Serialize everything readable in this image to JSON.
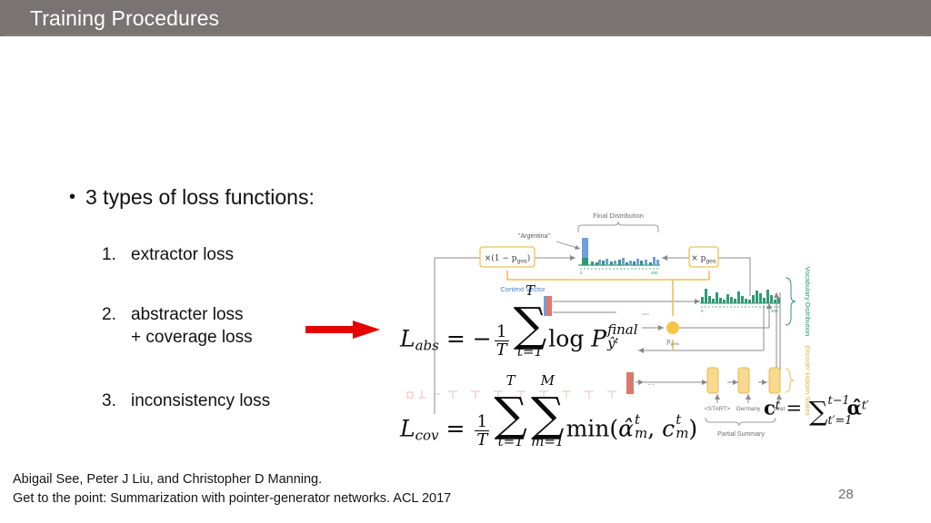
{
  "slide": {
    "title": "Training Procedures",
    "title_bar_color": "#7a7472",
    "background_color": "#ffffff",
    "page_number": "28"
  },
  "content": {
    "lead_bullet_glyph": "•",
    "lead_text": "3 types of loss functions:",
    "items": [
      {
        "index": "1.",
        "line1": "extractor loss",
        "line2": ""
      },
      {
        "index": "2.",
        "line1": "abstracter loss",
        "line2": "+ coverage loss"
      },
      {
        "index": "3.",
        "line1": "inconsistency loss",
        "line2": ""
      }
    ]
  },
  "arrow": {
    "name": "red-arrow",
    "color": "#E60000",
    "direction": "right"
  },
  "equations": {
    "abs": {
      "lhs": "L",
      "lhs_sub": "abs",
      "eq": "=",
      "minus": "−",
      "frac_num": "1",
      "frac_den": "T",
      "sigma": "∑",
      "sigma_top": "T",
      "sigma_bottom": "t=1",
      "log": "log",
      "p": "P",
      "p_sup": "final",
      "p_sub": "ŷᵗ"
    },
    "cov": {
      "lhs": "L",
      "lhs_sub": "cov",
      "eq": "=",
      "frac_num": "1",
      "frac_den": "T",
      "sigma1": "∑",
      "sigma1_top": "T",
      "sigma1_bottom": "t=1",
      "sigma2": "∑",
      "sigma2_top": "M",
      "sigma2_bottom": "m=1",
      "min": "min(",
      "alpha": "α̂",
      "alpha_sup": "t",
      "alpha_sub": "m",
      "comma": ", ",
      "c": "c",
      "c_sup": "t",
      "c_sub": "m",
      "close": ")"
    },
    "ct": {
      "lhs": "c",
      "lhs_sup": "t",
      "eq": "=",
      "sigma": "∑",
      "sigma_top": "t−1",
      "sigma_bottom": "t′=1",
      "alpha": "α̂",
      "alpha_sup": "t′"
    }
  },
  "figure": {
    "caption_final_distribution": "Final Distribution",
    "label_argentina": "\"Argentina\"",
    "label_times_one_minus_pgen": "×(1 − p",
    "label_times_one_minus_pgen_sub": "gen",
    "label_times_one_minus_pgen_end": ")",
    "label_times_pgen": "× p",
    "label_times_pgen_sub": "gen",
    "label_context_vector": "Context Vector",
    "label_vocabulary_distribution": "Vocabulary Distribution",
    "label_decoder_hidden_states": "Decoder Hidden States",
    "label_pgen": "p",
    "label_pgen_sub": "gen",
    "label_partial_summary": "Partial Summary",
    "decoder_tokens": [
      "<START>",
      "Germany",
      "beat"
    ],
    "axis_start": "0",
    "axis_end": "200",
    "colors": {
      "green": "#27a376",
      "blue": "#5b8fd6",
      "yellow": "#f6c648",
      "yellow_fill": "#fbdd92",
      "red": "#e2766a",
      "grey_line": "#8a8a8a",
      "label_grey": "#6d6d6d",
      "label_blue": "#4a7fd4",
      "label_green": "#1f9a6f",
      "label_yellow": "#e3b13a",
      "faded_encoder": "#e8a69c"
    },
    "final_distribution_bars": [
      8,
      4,
      3,
      2,
      2,
      1,
      5,
      2,
      1,
      1,
      2,
      1,
      1,
      1,
      2,
      6,
      4,
      3,
      2,
      5,
      3,
      2,
      2,
      6,
      4,
      2,
      2,
      1,
      2,
      3,
      2,
      5,
      2,
      1,
      2,
      2,
      1,
      3,
      2,
      1
    ],
    "vocabulary_distribution_bars": [
      3,
      12,
      4,
      2,
      8,
      3,
      2,
      7,
      4,
      3,
      9,
      5,
      3,
      2,
      6,
      4,
      8,
      3,
      2,
      10,
      6,
      4,
      3,
      7,
      12,
      5,
      3,
      8,
      4,
      2,
      6,
      3,
      2,
      5,
      3,
      2
    ]
  },
  "citation": {
    "line1": "Abigail See, Peter J Liu, and Christopher D Manning.",
    "line2": "Get to the point: Summarization with pointer-generator networks. ACL 2017"
  }
}
